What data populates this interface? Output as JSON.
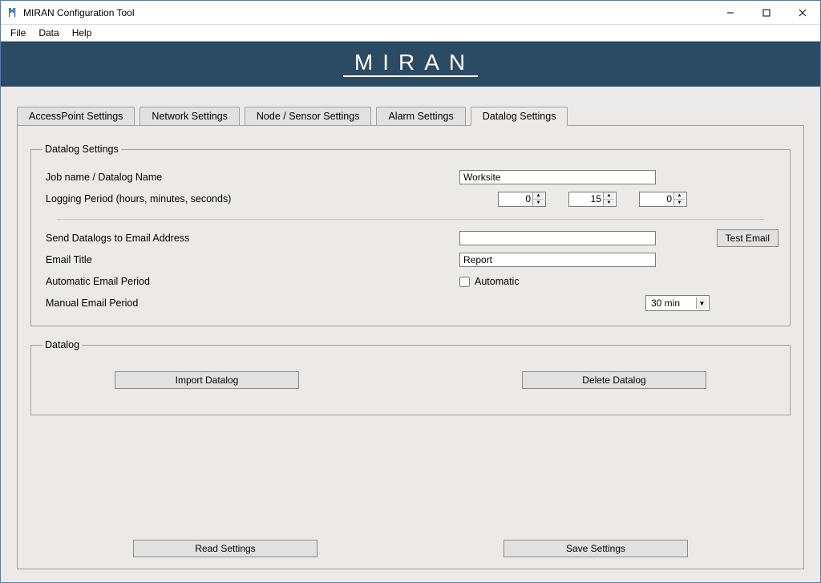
{
  "window": {
    "title": "MIRAN Configuration Tool"
  },
  "menubar": {
    "items": [
      "File",
      "Data",
      "Help"
    ]
  },
  "banner": {
    "logo_text": "MIRAN"
  },
  "tabs": [
    {
      "label": "AccessPoint Settings"
    },
    {
      "label": "Network Settings"
    },
    {
      "label": "Node / Sensor Settings"
    },
    {
      "label": "Alarm Settings"
    },
    {
      "label": "Datalog Settings"
    }
  ],
  "active_tab": 4,
  "datalog_settings": {
    "legend": "Datalog Settings",
    "job_name_label": "Job name / Datalog Name",
    "job_name_value": "Worksite",
    "logging_period_label": "Logging Period (hours, minutes, seconds)",
    "logging_period": {
      "hours": "0",
      "minutes": "15",
      "seconds": "0"
    },
    "send_email_label": "Send Datalogs to Email Address",
    "send_email_value": "",
    "email_title_label": "Email Title",
    "email_title_value": "Report",
    "auto_email_label": "Automatic Email Period",
    "auto_email_check_label": "Automatic",
    "auto_email_checked": false,
    "manual_email_label": "Manual Email Period",
    "manual_email_value": "30 min",
    "test_email_btn": "Test Email"
  },
  "datalog_group": {
    "legend": "Datalog",
    "import_btn": "Import Datalog",
    "delete_btn": "Delete Datalog"
  },
  "bottom": {
    "read_btn": "Read Settings",
    "save_btn": "Save Settings"
  }
}
